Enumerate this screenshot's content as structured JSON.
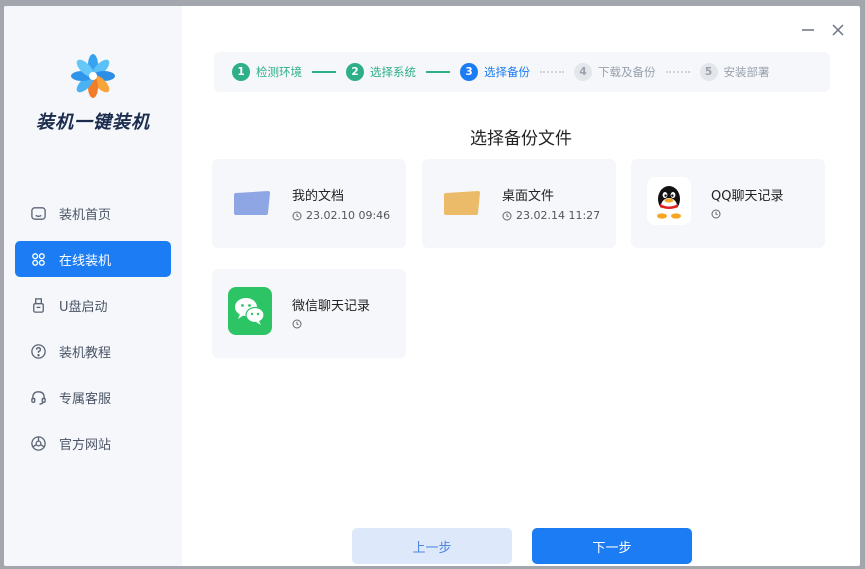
{
  "app": {
    "brand": "装机一键装机"
  },
  "sidebar": {
    "items": [
      {
        "label": "装机首页",
        "icon": "home-icon"
      },
      {
        "label": "在线装机",
        "icon": "online-install-icon",
        "active": true
      },
      {
        "label": "U盘启动",
        "icon": "usb-icon"
      },
      {
        "label": "装机教程",
        "icon": "help-icon"
      },
      {
        "label": "专属客服",
        "icon": "headset-icon"
      },
      {
        "label": "官方网站",
        "icon": "browser-icon"
      }
    ]
  },
  "steps": [
    {
      "num": "1",
      "label": "检测环境",
      "state": "done"
    },
    {
      "num": "2",
      "label": "选择系统",
      "state": "done"
    },
    {
      "num": "3",
      "label": "选择备份",
      "state": "current"
    },
    {
      "num": "4",
      "label": "下载及备份",
      "state": "pending"
    },
    {
      "num": "5",
      "label": "安装部署",
      "state": "pending"
    }
  ],
  "main": {
    "title": "选择备份文件",
    "cards": [
      {
        "name": "我的文档",
        "date": "23.02.10 09:46",
        "icon": "folder-icon",
        "color": "#8ea6e4"
      },
      {
        "name": "桌面文件",
        "date": "23.02.14 11:27",
        "icon": "folder-icon",
        "color": "#ebbb6a"
      },
      {
        "name": "QQ聊天记录",
        "date": "",
        "icon": "qq-icon"
      },
      {
        "name": "微信聊天记录",
        "date": "",
        "icon": "wechat-icon",
        "color": "#2dc465"
      }
    ]
  },
  "buttons": {
    "prev": "上一步",
    "next": "下一步"
  },
  "colors": {
    "accent": "#1c7cf4",
    "done": "#2fae8a"
  }
}
